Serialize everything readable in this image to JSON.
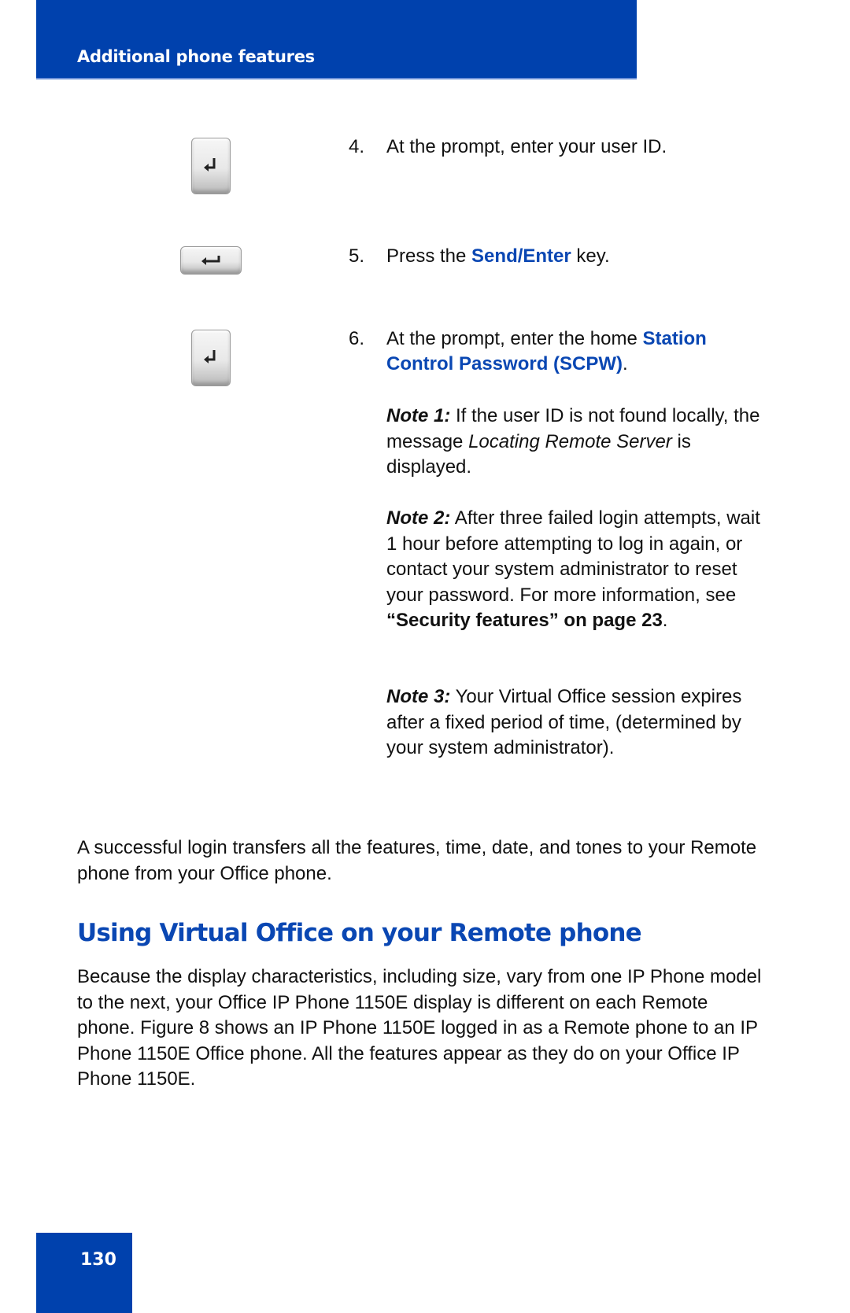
{
  "header": {
    "section_title": "Additional phone features"
  },
  "steps": [
    {
      "number": "4.",
      "text": "At the prompt, enter your user ID.",
      "key_icon": "enter-key-icon"
    },
    {
      "number": "5.",
      "text_before": "Press the ",
      "highlight": "Send/Enter",
      "text_after": " key.",
      "key_icon": "send-enter-key-icon"
    },
    {
      "number": "6.",
      "text_before": "At the prompt, enter the home ",
      "highlight": "Station Control Password (SCPW)",
      "text_after": ".",
      "key_icon": "enter-key-icon"
    }
  ],
  "notes": [
    {
      "label": "Note 1:",
      "text_before": " If the user ID is not found locally, the message ",
      "italic": "Locating Remote Server",
      "text_after": " is displayed."
    },
    {
      "label": "Note 2:",
      "text_before": " After three failed login attempts, wait 1 hour before attempting to log in again, or contact your system administrator to reset your password. For more information, see ",
      "link": "“Security features” on page 23",
      "text_after": "."
    },
    {
      "label": "Note 3:",
      "text": " Your Virtual Office session expires after a fixed period of time, (determined by your system administrator)."
    }
  ],
  "summary_paragraph": "A successful login transfers all the features, time, date, and tones to your Remote phone from your Office phone.",
  "section": {
    "heading": "Using Virtual Office on your Remote phone",
    "paragraph": "Because the display characteristics, including size, vary from one IP Phone model to the next, your Office IP Phone 1150E display is different on each Remote phone. Figure 8 shows an IP Phone 1150E logged in as a Remote phone to an IP Phone 1150E Office phone. All the features appear as they do on your Office IP Phone 1150E."
  },
  "footer": {
    "page_number": "130"
  },
  "colors": {
    "brand_blue": "#0041ad",
    "link_blue": "#0a47b3"
  }
}
